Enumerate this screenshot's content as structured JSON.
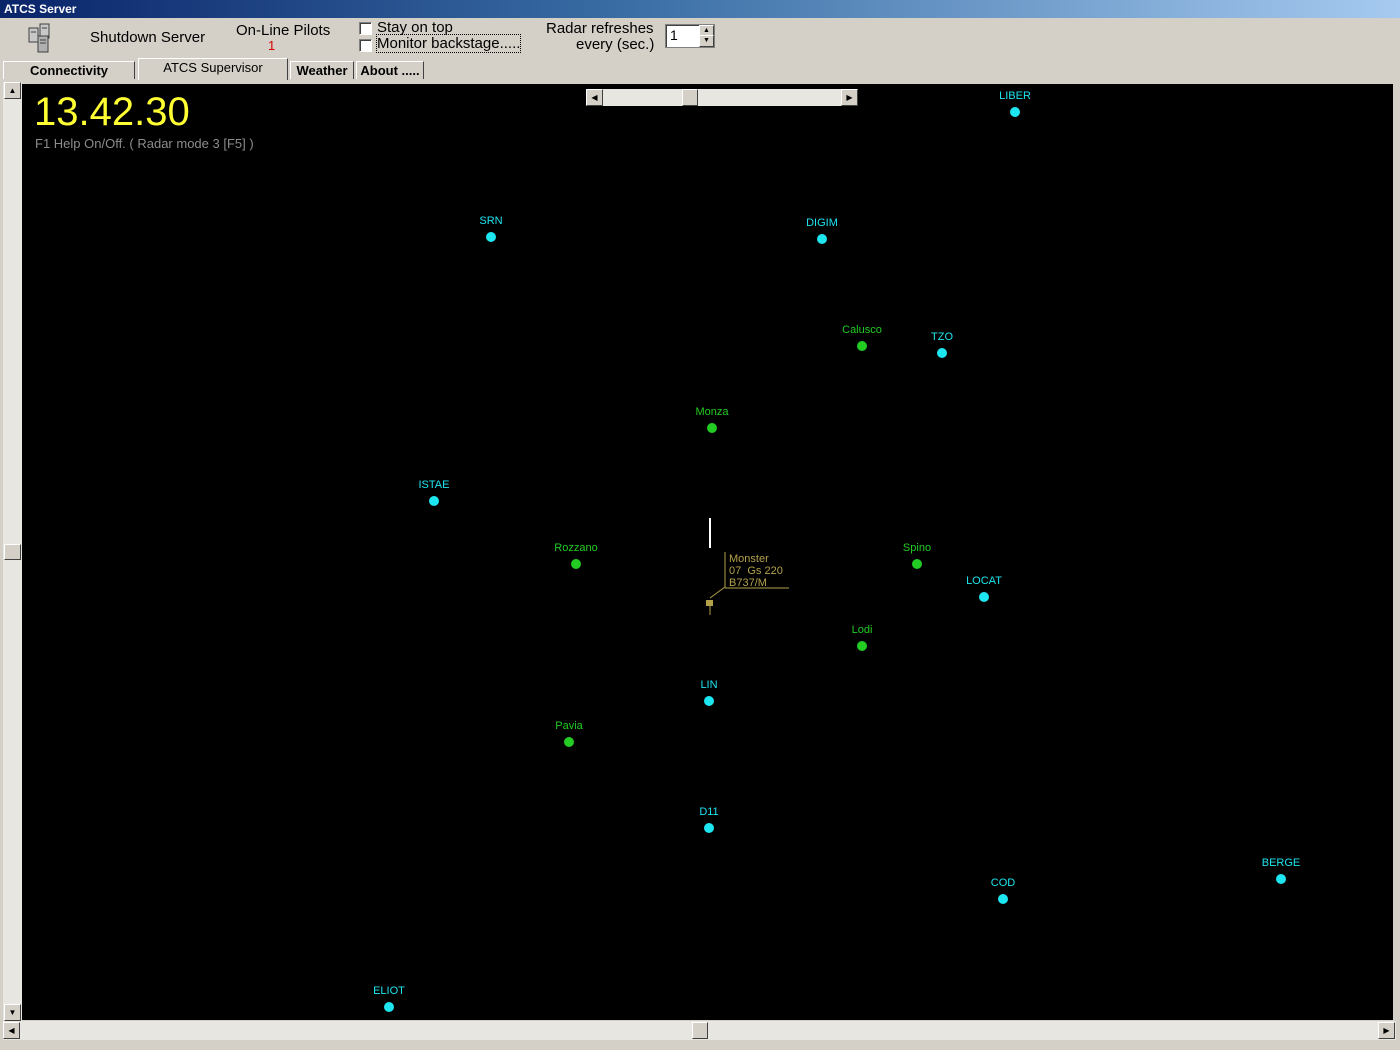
{
  "window": {
    "title": "ATCS Server"
  },
  "toolbar": {
    "shutdown_label": "Shutdown Server",
    "online_pilots_label": "On-Line Pilots",
    "online_pilots_count": "1",
    "stay_on_top_label": "Stay on top",
    "monitor_backstage_label": "Monitor backstage.....",
    "radar_refresh_label_1": "Radar refreshes",
    "radar_refresh_label_2": "every (sec.)",
    "radar_refresh_value": "1"
  },
  "tabs": [
    {
      "label": "Connectivity"
    },
    {
      "label": "ATCS Supervisor"
    },
    {
      "label": "Weather"
    },
    {
      "label": "About ....."
    }
  ],
  "radar": {
    "clock": "13.42.30",
    "help_text": "F1 Help On/Off.  ( Radar mode 3 [F5] )",
    "aircraft": {
      "callsign": "Monster",
      "line2": "07  Gs 220",
      "type": "B737/M"
    },
    "waypoints": [
      {
        "name": "LIBER",
        "kind": "fix"
      },
      {
        "name": "SRN",
        "kind": "fix"
      },
      {
        "name": "DIGIM",
        "kind": "fix"
      },
      {
        "name": "Calusco",
        "kind": "town"
      },
      {
        "name": "TZO",
        "kind": "fix"
      },
      {
        "name": "Monza",
        "kind": "town"
      },
      {
        "name": "ISTAE",
        "kind": "fix"
      },
      {
        "name": "Rozzano",
        "kind": "town"
      },
      {
        "name": "Spino",
        "kind": "town"
      },
      {
        "name": "LOCAT",
        "kind": "fix"
      },
      {
        "name": "Lodi",
        "kind": "town"
      },
      {
        "name": "LIN",
        "kind": "fix"
      },
      {
        "name": "Pavia",
        "kind": "town"
      },
      {
        "name": "D11",
        "kind": "fix"
      },
      {
        "name": "BERGE",
        "kind": "fix"
      },
      {
        "name": "COD",
        "kind": "fix"
      },
      {
        "name": "ELIOT",
        "kind": "fix"
      }
    ]
  },
  "colors": {
    "fix": "#1ee6f0",
    "town": "#22cc22",
    "clock": "#ffff33",
    "aircraft": "#b3a14a",
    "online_count": "#d40000"
  }
}
